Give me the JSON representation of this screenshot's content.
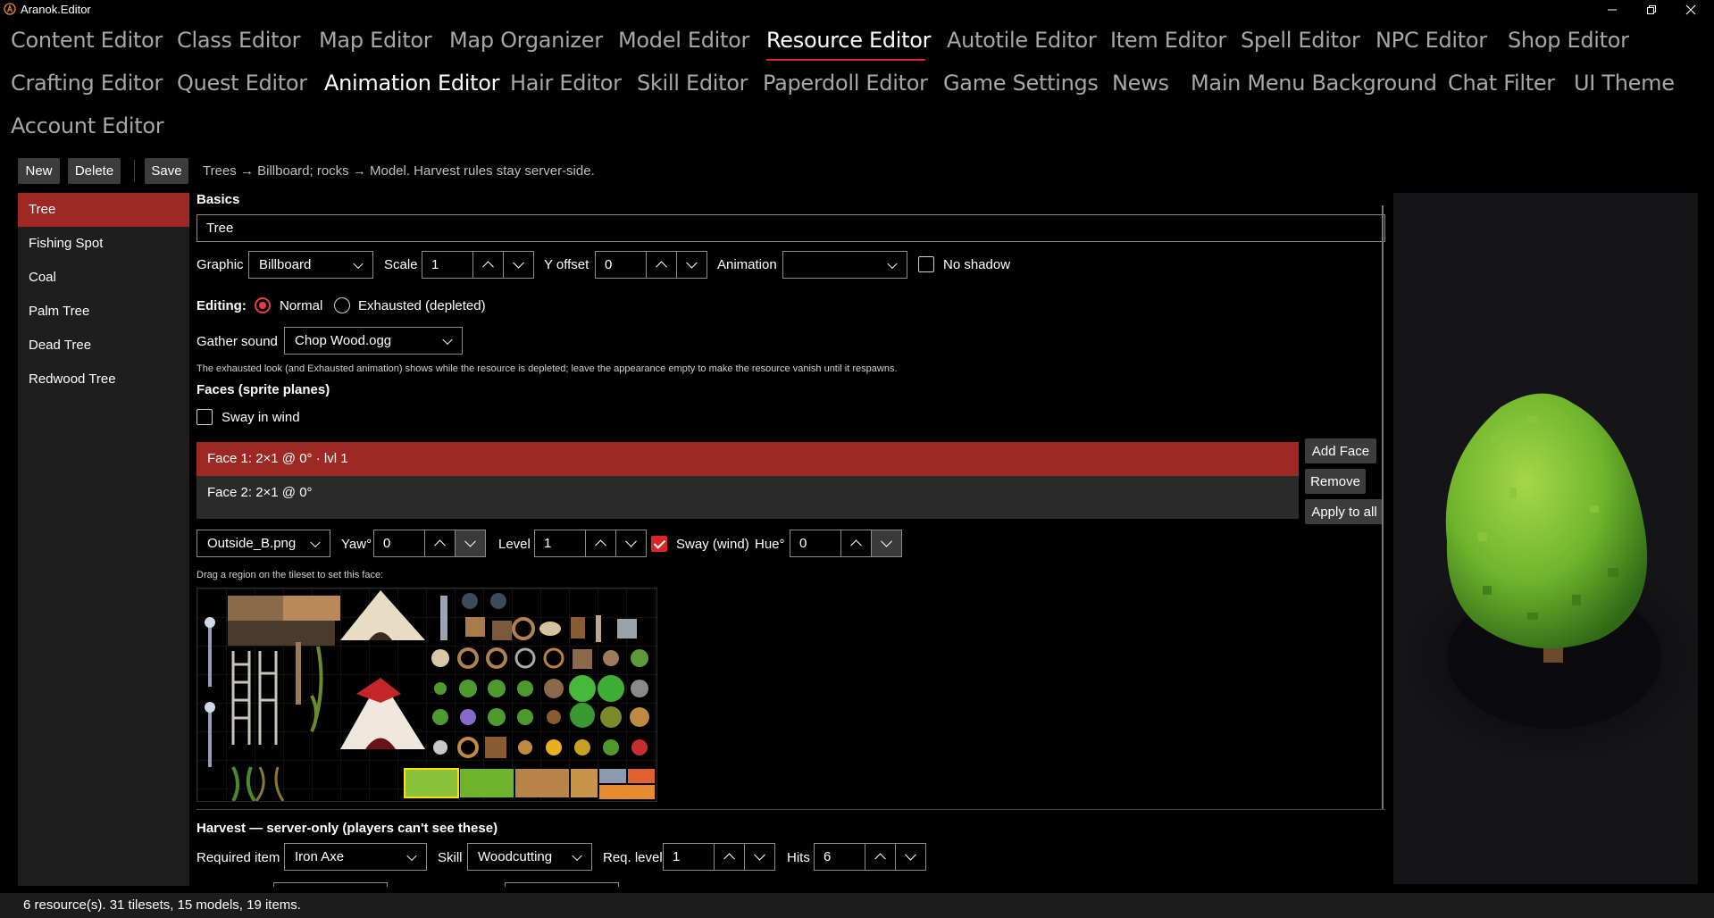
{
  "window": {
    "title": "Aranok.Editor",
    "controls": [
      "minimize",
      "maximize",
      "close"
    ]
  },
  "tabs": [
    {
      "label": "Content Editor"
    },
    {
      "label": "Class Editor"
    },
    {
      "label": "Map Editor"
    },
    {
      "label": "Map Organizer"
    },
    {
      "label": "Model Editor"
    },
    {
      "label": "Resource Editor",
      "active": true
    },
    {
      "label": "Autotile Editor"
    },
    {
      "label": "Item Editor"
    },
    {
      "label": "Spell Editor"
    },
    {
      "label": "NPC Editor"
    },
    {
      "label": "Shop Editor"
    },
    {
      "label": "Crafting Editor"
    },
    {
      "label": "Quest Editor"
    },
    {
      "label": "Animation Editor"
    },
    {
      "label": "Hair Editor"
    },
    {
      "label": "Skill Editor"
    },
    {
      "label": "Paperdoll Editor"
    },
    {
      "label": "Game Settings"
    },
    {
      "label": "News"
    },
    {
      "label": "Main Menu Background"
    },
    {
      "label": "Chat Filter"
    },
    {
      "label": "UI Theme"
    },
    {
      "label": "Account Editor"
    }
  ],
  "toolbar": {
    "new_label": "New",
    "delete_label": "Delete",
    "save_label": "Save",
    "hint": "Trees → Billboard; rocks → Model. Harvest rules stay server-side."
  },
  "resources": [
    {
      "label": "Tree",
      "selected": true
    },
    {
      "label": "Fishing Spot"
    },
    {
      "label": "Coal"
    },
    {
      "label": "Palm Tree"
    },
    {
      "label": "Dead Tree"
    },
    {
      "label": "Redwood Tree"
    }
  ],
  "basics": {
    "section_label": "Basics",
    "name_value": "Tree",
    "graphic_label": "Graphic",
    "graphic_value": "Billboard",
    "scale_label": "Scale",
    "scale_value": "1",
    "yoffset_label": "Y offset",
    "yoffset_value": "0",
    "animation_label": "Animation",
    "animation_value": "",
    "noshadow_label": "No shadow",
    "noshadow_checked": false,
    "editing_label": "Editing:",
    "normal_label": "Normal",
    "exhausted_label": "Exhausted (depleted)",
    "editing_mode": "Normal",
    "gather_label": "Gather sound",
    "gather_value": "Chop Wood.ogg",
    "note": "The exhausted look (and Exhausted animation) shows while the resource is depleted; leave the appearance empty to make the resource vanish until it respawns."
  },
  "faces": {
    "section_label": "Faces (sprite planes)",
    "sway_label": "Sway in wind",
    "sway_checked": false,
    "items": [
      {
        "label": "Face 1: 2×1 @ 0° · lvl 1",
        "selected": true
      },
      {
        "label": "Face 2: 2×1 @ 0°"
      }
    ],
    "add_label": "Add Face",
    "remove_label": "Remove",
    "apply_label": "Apply to all",
    "tileset_value": "Outside_B.png",
    "yaw_label": "Yaw°",
    "yaw_value": "0",
    "level_label": "Level",
    "level_value": "1",
    "face_sway_label": "Sway (wind)",
    "face_sway_checked": true,
    "hue_label": "Hue°",
    "hue_value": "0",
    "drag_hint": "Drag a region on the tileset to set this face:"
  },
  "harvest": {
    "section_label": "Harvest — server-only (players can't see these)",
    "required_label": "Required item",
    "required_value": "Iron Axe",
    "skill_label": "Skill",
    "skill_value": "Woodcutting",
    "reqlevel_label": "Req. level",
    "reqlevel_value": "1",
    "hits_label": "Hits",
    "hits_value": "6"
  },
  "status": {
    "text": "6 resource(s). 31 tilesets, 15 models, 19 items."
  },
  "colors": {
    "accent": "#d9262a",
    "selection": "#9d2824",
    "panel": "#1e1e1e",
    "tree_green": "#6fb52c"
  }
}
